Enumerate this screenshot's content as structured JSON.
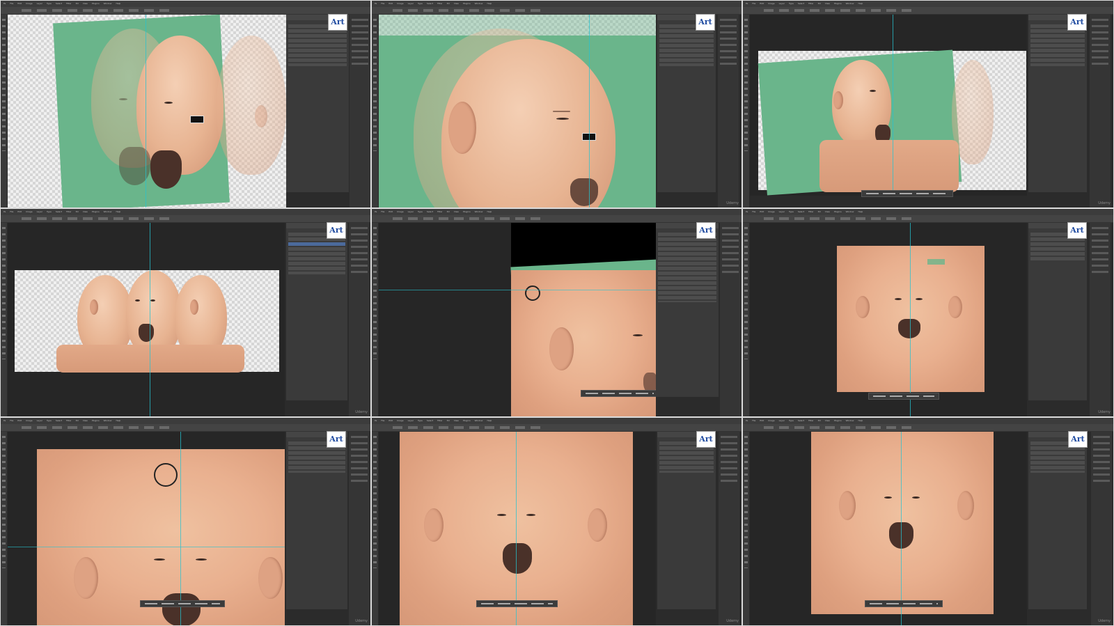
{
  "menu": [
    "Ps",
    "File",
    "Edit",
    "Image",
    "Layer",
    "Type",
    "Select",
    "Filter",
    "3D",
    "View",
    "Plugins",
    "Window",
    "Help"
  ],
  "logo_text": "Art",
  "watermark": "Udemy"
}
